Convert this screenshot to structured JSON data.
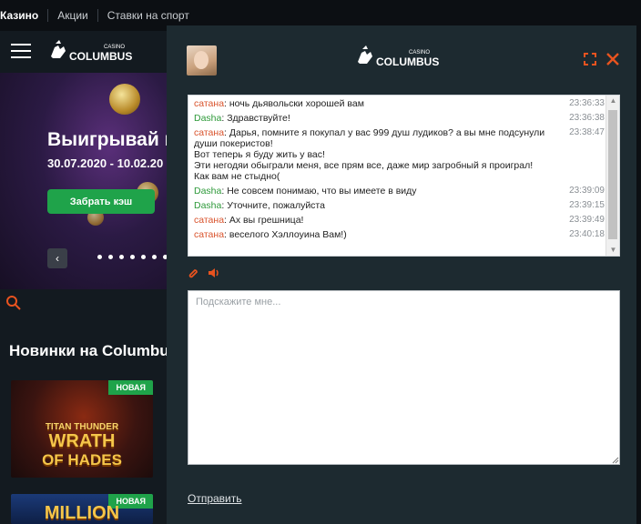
{
  "topnav": {
    "tabs": [
      {
        "label": "Казино",
        "active": true
      },
      {
        "label": "Акции",
        "active": false
      },
      {
        "label": "Ставки на спорт",
        "active": false
      }
    ]
  },
  "banner": {
    "title": "Выигрывай к",
    "dates": "30.07.2020 - 10.02.20",
    "button": "Забрать кэш",
    "prev_icon": "chevron-left-icon"
  },
  "section": {
    "title": "Новинки на Columbus"
  },
  "games": [
    {
      "badge": "НОВАЯ",
      "line1": "TITAN THUNDER",
      "line2": "WRATH",
      "line3": "OF HADES"
    },
    {
      "badge": "НОВАЯ",
      "line1": "MILLION"
    }
  ],
  "logo": {
    "small": "CASINO",
    "name": "COLUMBUS"
  },
  "chat": {
    "messages": [
      {
        "author": "сатана",
        "role": "operator",
        "text": "ночь дьявольски хорошей вам",
        "time": "23:36:33"
      },
      {
        "author": "Dasha",
        "role": "agent",
        "text": "Здравствуйте!",
        "time": "23:36:38"
      },
      {
        "author": "сатана",
        "role": "operator",
        "lines": [
          "Дарья, помните я покупал у вас 999 душ лудиков? а вы мне подсунули души покеристов!",
          "Вот теперь я буду жить у вас!",
          "Эти негодяи обыграли меня, все прям все, даже мир загробный я проиграл!",
          "Как вам не стыдно("
        ],
        "time": "23:38:47"
      },
      {
        "author": "Dasha",
        "role": "agent",
        "text": "Не совсем понимаю, что вы имеете в виду",
        "time": "23:39:09"
      },
      {
        "author": "Dasha",
        "role": "agent",
        "text": "Уточните, пожалуйста",
        "time": "23:39:15"
      },
      {
        "author": "сатана",
        "role": "operator",
        "text": "Ах вы грешница!",
        "time": "23:39:49"
      },
      {
        "author": "сатана",
        "role": "operator",
        "text": "веселого Хэллоуина Вам!)",
        "time": "23:40:18"
      }
    ],
    "input_placeholder": "Подскажите мне...",
    "send_label": "Отправить",
    "colors": {
      "operator": "#d9532c",
      "agent": "#2e9a3a",
      "accent": "#e8531f"
    }
  }
}
